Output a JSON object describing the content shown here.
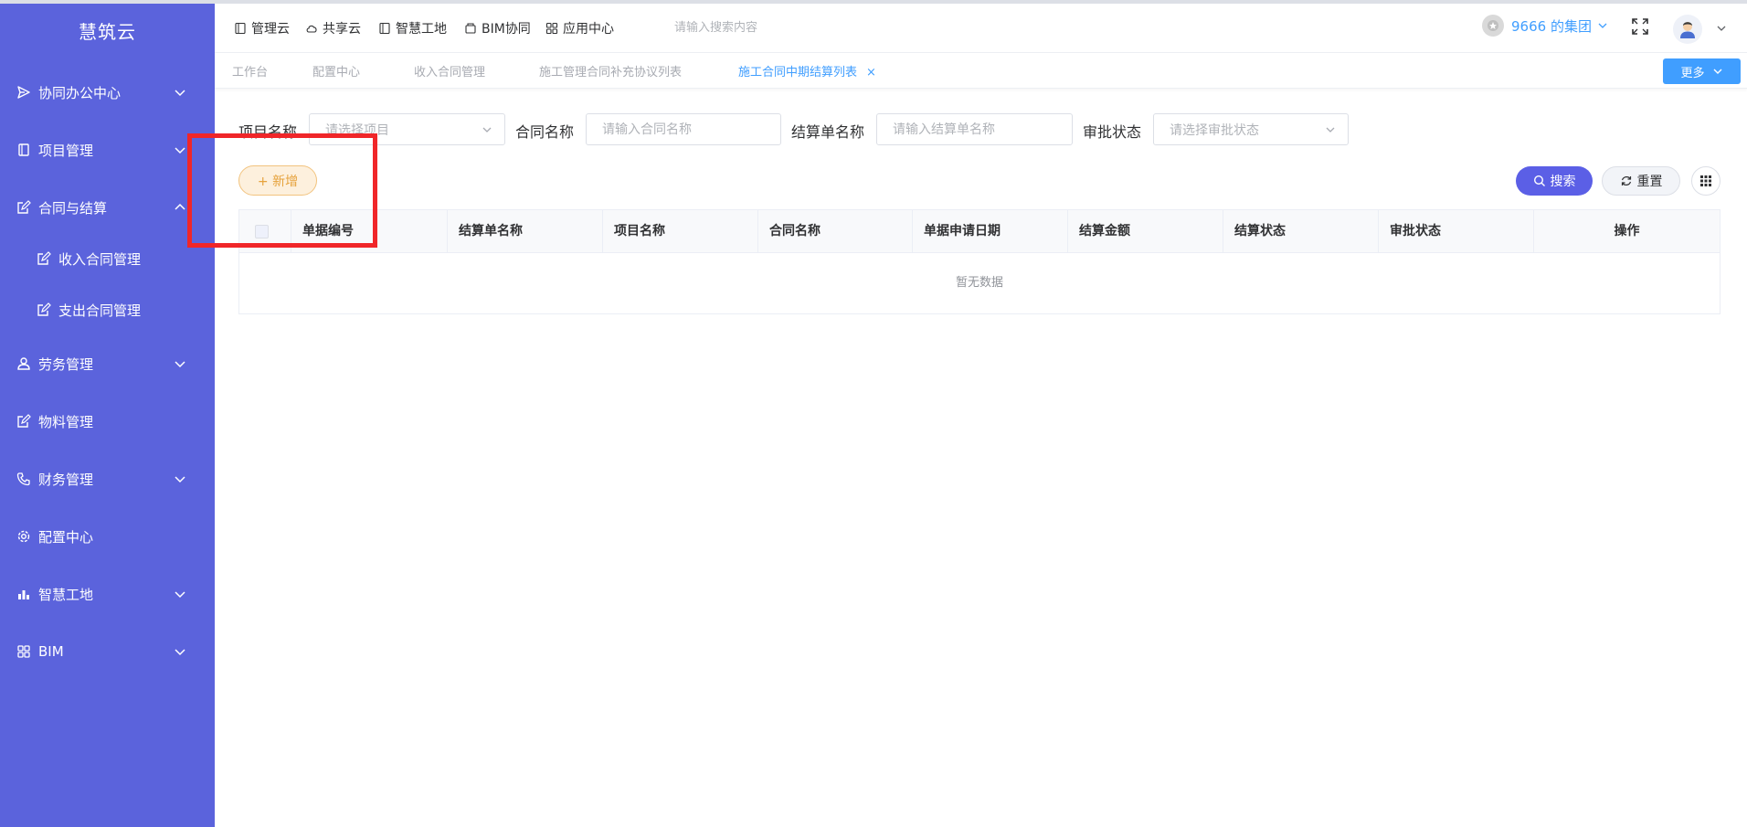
{
  "sidebar": {
    "brand": "慧筑云",
    "items": [
      {
        "label": "协同办公中心"
      },
      {
        "label": "项目管理"
      },
      {
        "label": "合同与结算"
      },
      {
        "label": "劳务管理"
      },
      {
        "label": "物料管理"
      },
      {
        "label": "财务管理"
      },
      {
        "label": "配置中心"
      },
      {
        "label": "智慧工地"
      },
      {
        "label": "BIM"
      }
    ],
    "sub_items": [
      {
        "label": "收入合同管理"
      },
      {
        "label": "支出合同管理"
      }
    ]
  },
  "header": {
    "nav": [
      {
        "label": "管理云",
        "icon": "book-icon"
      },
      {
        "label": "共享云",
        "icon": "cloud-icon"
      },
      {
        "label": "智慧工地",
        "icon": "book-icon"
      },
      {
        "label": "BIM协同",
        "icon": "box-icon"
      },
      {
        "label": "应用中心",
        "icon": "grid-icon"
      }
    ],
    "search_placeholder": "请输入搜索内容",
    "org_name": "9666 的集团"
  },
  "tabs": {
    "items": [
      {
        "label": "工作台"
      },
      {
        "label": "配置中心"
      },
      {
        "label": "收入合同管理"
      },
      {
        "label": "施工管理合同补充协议列表"
      },
      {
        "label": "施工合同中期结算列表",
        "active": true
      }
    ],
    "close": "×",
    "more_label": "更多"
  },
  "filters": {
    "project_label": "项目名称",
    "project_placeholder": "请选择项目",
    "contract_label": "合同名称",
    "contract_placeholder": "请输入合同名称",
    "settlement_label": "结算单名称",
    "settlement_placeholder": "请输入结算单名称",
    "approval_label": "审批状态",
    "approval_placeholder": "请选择审批状态"
  },
  "actions": {
    "add_label": "+ 新增",
    "search_label": "搜索",
    "reset_label": "重置"
  },
  "table": {
    "columns": [
      "单据编号",
      "结算单名称",
      "项目名称",
      "合同名称",
      "单据申请日期",
      "结算金额",
      "结算状态",
      "审批状态",
      "操作"
    ],
    "empty_text": "暂无数据"
  },
  "colors": {
    "sidebar": "#5b63dc",
    "primary": "#409eff",
    "search_button": "#5b5fe6",
    "add_button": "#e6a23c",
    "annotation": "#f02629"
  }
}
